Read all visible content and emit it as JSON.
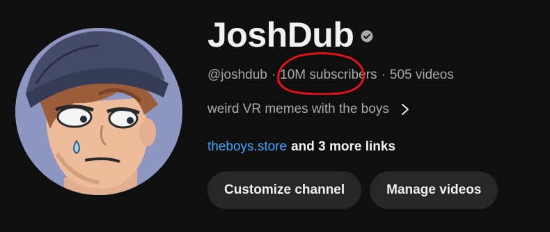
{
  "channel": {
    "name": "JoshDub",
    "handle": "@joshdub",
    "subscribers": "10M subscribers",
    "videos": "505 videos",
    "separator": "·",
    "description": "weird VR memes with the boys",
    "link_text": "theboys.store",
    "more_links": "and 3 more links"
  },
  "buttons": {
    "customize_label": "Customize channel",
    "manage_label": "Manage videos"
  },
  "icons": {
    "verified": "verified-checkmark-icon",
    "chevron": "chevron-right-icon"
  },
  "colors": {
    "background": "#0f0f0f",
    "primary_text": "#f1f1f1",
    "secondary_text": "#aaaaaa",
    "link": "#3ea6ff",
    "button_bg": "#272727",
    "annotation": "#e3121a"
  }
}
